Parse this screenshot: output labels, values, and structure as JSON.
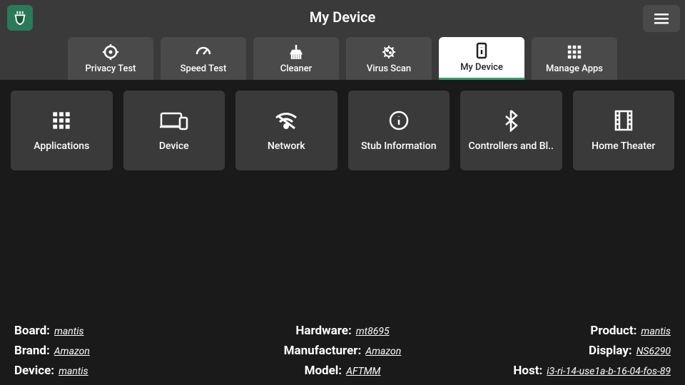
{
  "title": "My Device",
  "tabs": [
    {
      "label": "Privacy Test",
      "icon": "crosshair"
    },
    {
      "label": "Speed Test",
      "icon": "gauge"
    },
    {
      "label": "Cleaner",
      "icon": "broom"
    },
    {
      "label": "Virus Scan",
      "icon": "virus"
    },
    {
      "label": "My Device",
      "icon": "phone-info",
      "active": true
    },
    {
      "label": "Manage Apps",
      "icon": "grid"
    }
  ],
  "cards": [
    {
      "label": "Applications",
      "icon": "grid"
    },
    {
      "label": "Device",
      "icon": "devices"
    },
    {
      "label": "Network",
      "icon": "wifi"
    },
    {
      "label": "Stub Information",
      "icon": "info"
    },
    {
      "label": "Controllers and Bl..",
      "icon": "bluetooth"
    },
    {
      "label": "Home Theater",
      "icon": "film"
    }
  ],
  "info": {
    "board": {
      "key": "Board:",
      "value": "mantis"
    },
    "hardware": {
      "key": "Hardware:",
      "value": "mt8695"
    },
    "product": {
      "key": "Product:",
      "value": "mantis"
    },
    "brand": {
      "key": "Brand:",
      "value": "Amazon"
    },
    "manufacturer": {
      "key": "Manufacturer:",
      "value": "Amazon"
    },
    "display": {
      "key": "Display:",
      "value": "NS6290"
    },
    "device": {
      "key": "Device:",
      "value": "mantis"
    },
    "model": {
      "key": "Model:",
      "value": "AFTMM"
    },
    "host": {
      "key": "Host:",
      "value": "i3-ri-14-use1a-b-16-04-fos-89"
    }
  }
}
